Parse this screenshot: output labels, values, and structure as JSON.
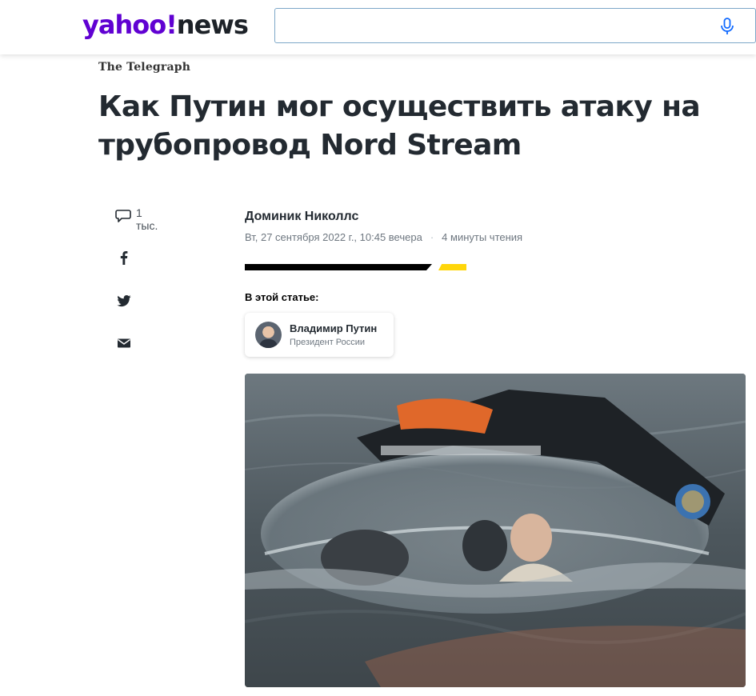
{
  "header": {
    "logo_left": "yahoo!",
    "logo_right": "news",
    "search_value": "",
    "brand_color": "#6001d2"
  },
  "article": {
    "source": "The Telegraph",
    "title_part1": "Как Путин мог осуществить атаку на трубопровод ",
    "title_part2": "Nord Stream",
    "author": "Доминик Николлс",
    "date": "Вт, 27 сентября 2022 г., 10:45 вечера",
    "meta_separator": "·",
    "read_time": "4 минуты чтения",
    "in_article_label": "В этой статье:",
    "person": {
      "name": "Владимир Путин",
      "role": "Президент России"
    }
  },
  "share": {
    "comment_count": "1",
    "comment_unit": "тыс.",
    "icons": [
      "comment-icon",
      "facebook-icon",
      "twitter-icon",
      "email-icon"
    ]
  },
  "colors": {
    "accent_yellow": "#ffd60a",
    "title_text": "#232a31"
  }
}
